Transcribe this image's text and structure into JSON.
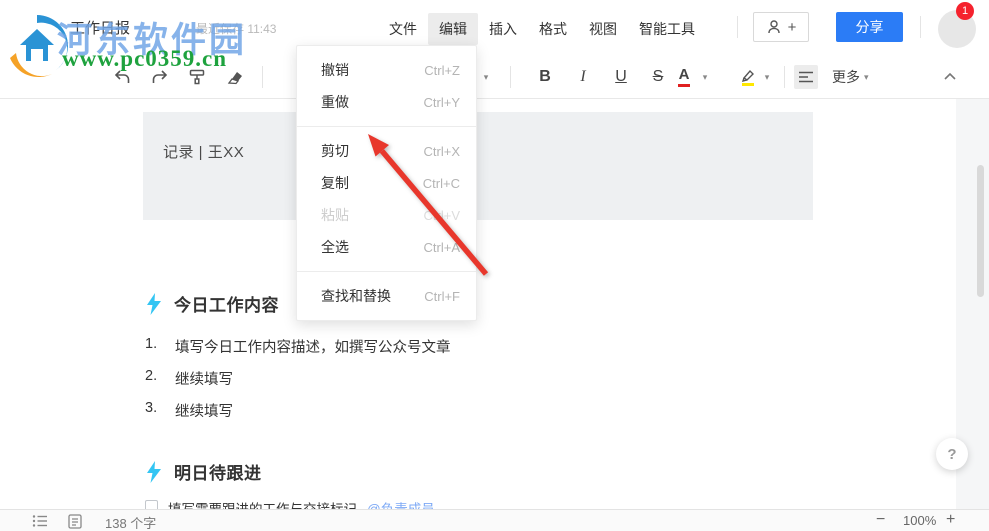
{
  "watermark": {
    "site_name": "河东软件园",
    "site_url": "www.pc0359.cn"
  },
  "topbar": {
    "doc_title": "工作日报",
    "save_status": "最近保存 11:43",
    "menus": [
      {
        "label": "文件"
      },
      {
        "label": "编辑"
      },
      {
        "label": "插入"
      },
      {
        "label": "格式"
      },
      {
        "label": "视图"
      },
      {
        "label": "智能工具"
      }
    ],
    "invite_plus": "+",
    "share_label": "分享",
    "notification_count": "1"
  },
  "toolbar": {
    "bold": "B",
    "italic": "I",
    "underline": "U",
    "strikethrough": "S",
    "font_color": "A",
    "more_label": "更多"
  },
  "edit_menu": {
    "items": [
      {
        "label": "撤销",
        "shortcut": "Ctrl+Z"
      },
      {
        "label": "重做",
        "shortcut": "Ctrl+Y"
      },
      {
        "label": "剪切",
        "shortcut": "Ctrl+X"
      },
      {
        "label": "复制",
        "shortcut": "Ctrl+C"
      },
      {
        "label": "粘贴",
        "shortcut": "Ctrl+V",
        "disabled": true
      },
      {
        "label": "全选",
        "shortcut": "Ctrl+A"
      },
      {
        "label": "查找和替换",
        "shortcut": "Ctrl+F"
      }
    ]
  },
  "document": {
    "meta_line": "记录 | 王XX",
    "section1_title": "今日工作内容",
    "list_items": [
      {
        "num": "1.",
        "text": "填写今日工作内容描述，如撰写公众号文章"
      },
      {
        "num": "2.",
        "text": "继续填写"
      },
      {
        "num": "3.",
        "text": "继续填写"
      }
    ],
    "section2_title": "明日待跟进",
    "partial_line": {
      "text": "填写需要跟进的工作与交接标记",
      "mention": "@负责成员"
    }
  },
  "bottombar": {
    "word_count": "138 个字",
    "zoom_out": "−",
    "zoom_level": "100%",
    "zoom_in": "+"
  },
  "help_label": "?",
  "colors": {
    "accent_blue": "#2b7cf6",
    "lightning_cyan": "#33c5f3",
    "arrow_red": "#e8372c",
    "badge_red": "#f5222d",
    "mention_blue": "#7da9f5",
    "meta_block_gray": "#eef0f2"
  }
}
